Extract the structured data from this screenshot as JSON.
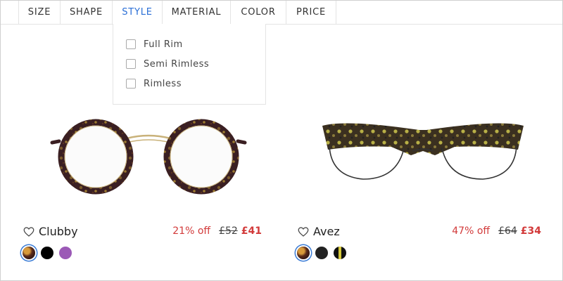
{
  "filters": {
    "tabs": [
      {
        "label": "SIZE"
      },
      {
        "label": "SHAPE"
      },
      {
        "label": "STYLE"
      },
      {
        "label": "MATERIAL"
      },
      {
        "label": "COLOR"
      },
      {
        "label": "PRICE"
      }
    ],
    "active_tab": "STYLE",
    "style_options": [
      {
        "label": "Full Rim",
        "checked": false
      },
      {
        "label": "Semi Rimless",
        "checked": false
      },
      {
        "label": "Rimless",
        "checked": false
      }
    ]
  },
  "products": [
    {
      "name": "Clubby",
      "discount": "21% off",
      "old_price": "£52",
      "price": "£41",
      "swatches": [
        {
          "color": "tortoise",
          "selected": true
        },
        {
          "color": "#000000",
          "selected": false
        },
        {
          "color": "#9b59b6",
          "selected": false
        }
      ]
    },
    {
      "name": "Avez",
      "discount": "47% off",
      "old_price": "£64",
      "price": "£34",
      "swatches": [
        {
          "color": "tortoise",
          "selected": true
        },
        {
          "color": "#222222",
          "selected": false
        },
        {
          "color": "black-yellow",
          "selected": false
        }
      ]
    }
  ],
  "colors": {
    "accent": "#2b6fd6",
    "sale_red": "#d23a3a",
    "border": "#e4e4e4"
  },
  "icons": {
    "favorite": "heart-outline-icon"
  }
}
